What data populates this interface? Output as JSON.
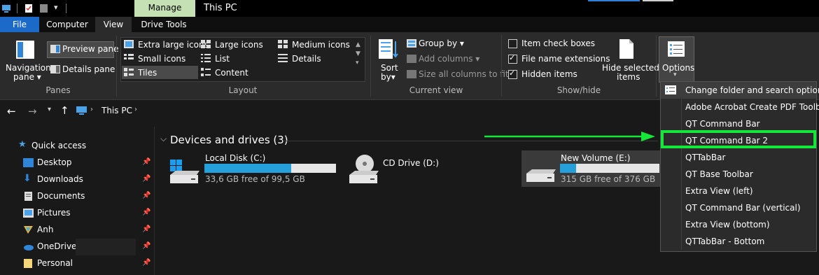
{
  "title_bar": {
    "manage_tab": "Manage",
    "window_title": "This PC"
  },
  "tabs": {
    "file": "File",
    "computer": "Computer",
    "view": "View",
    "drive_tools": "Drive Tools"
  },
  "ribbon": {
    "panes": {
      "navigation_pane": "Navigation",
      "navigation_pane_2": "pane",
      "preview_pane": "Preview pane",
      "details_pane": "Details pane",
      "group_label": "Panes"
    },
    "layout": {
      "extra_large_icons": "Extra large icons",
      "large_icons": "Large icons",
      "medium_icons": "Medium icons",
      "small_icons": "Small icons",
      "list": "List",
      "details": "Details",
      "tiles": "Tiles",
      "content": "Content",
      "group_label": "Layout"
    },
    "current_view": {
      "sort_by": "Sort",
      "sort_by_2": "by",
      "group_by": "Group by",
      "add_columns": "Add columns",
      "size_all_columns": "Size all columns to fit",
      "group_label": "Current view"
    },
    "show_hide": {
      "item_check_boxes": "Item check boxes",
      "file_name_extensions": "File name extensions",
      "hidden_items": "Hidden items",
      "hide_selected": "Hide selected",
      "hide_selected_2": "items",
      "group_label": "Show/hide"
    },
    "options": "Options"
  },
  "address": {
    "location": "This PC"
  },
  "nav": {
    "quick_access": "Quick access",
    "items": [
      "Desktop",
      "Downloads",
      "Documents",
      "Pictures",
      "Anh",
      "OneDrive",
      "Personal"
    ]
  },
  "content": {
    "section_header": "Devices and drives (3)",
    "drives": [
      {
        "name": "Local Disk (C:)",
        "free": "33,6 GB free of 99,5 GB",
        "used_fraction": 0.66
      },
      {
        "name": "CD Drive (D:)"
      },
      {
        "name": "New Volume (E:)",
        "free": "315 GB free of 376 GB",
        "used_fraction": 0.16
      }
    ]
  },
  "options_menu": {
    "items": [
      "Change folder and search options",
      "Adobe Acrobat Create PDF Toolbar",
      "QT Command Bar",
      "QT Command Bar 2",
      "QTTabBar",
      "QT Base Toolbar",
      "Extra View (left)",
      "QT Command Bar (vertical)",
      "Extra View (bottom)",
      "QTTabBar - Bottom"
    ]
  },
  "colors": {
    "accent": "#1b6ac9",
    "highlight": "#15e63a",
    "manage": "#c5e1b3",
    "drive_bar": "#26a0da"
  }
}
